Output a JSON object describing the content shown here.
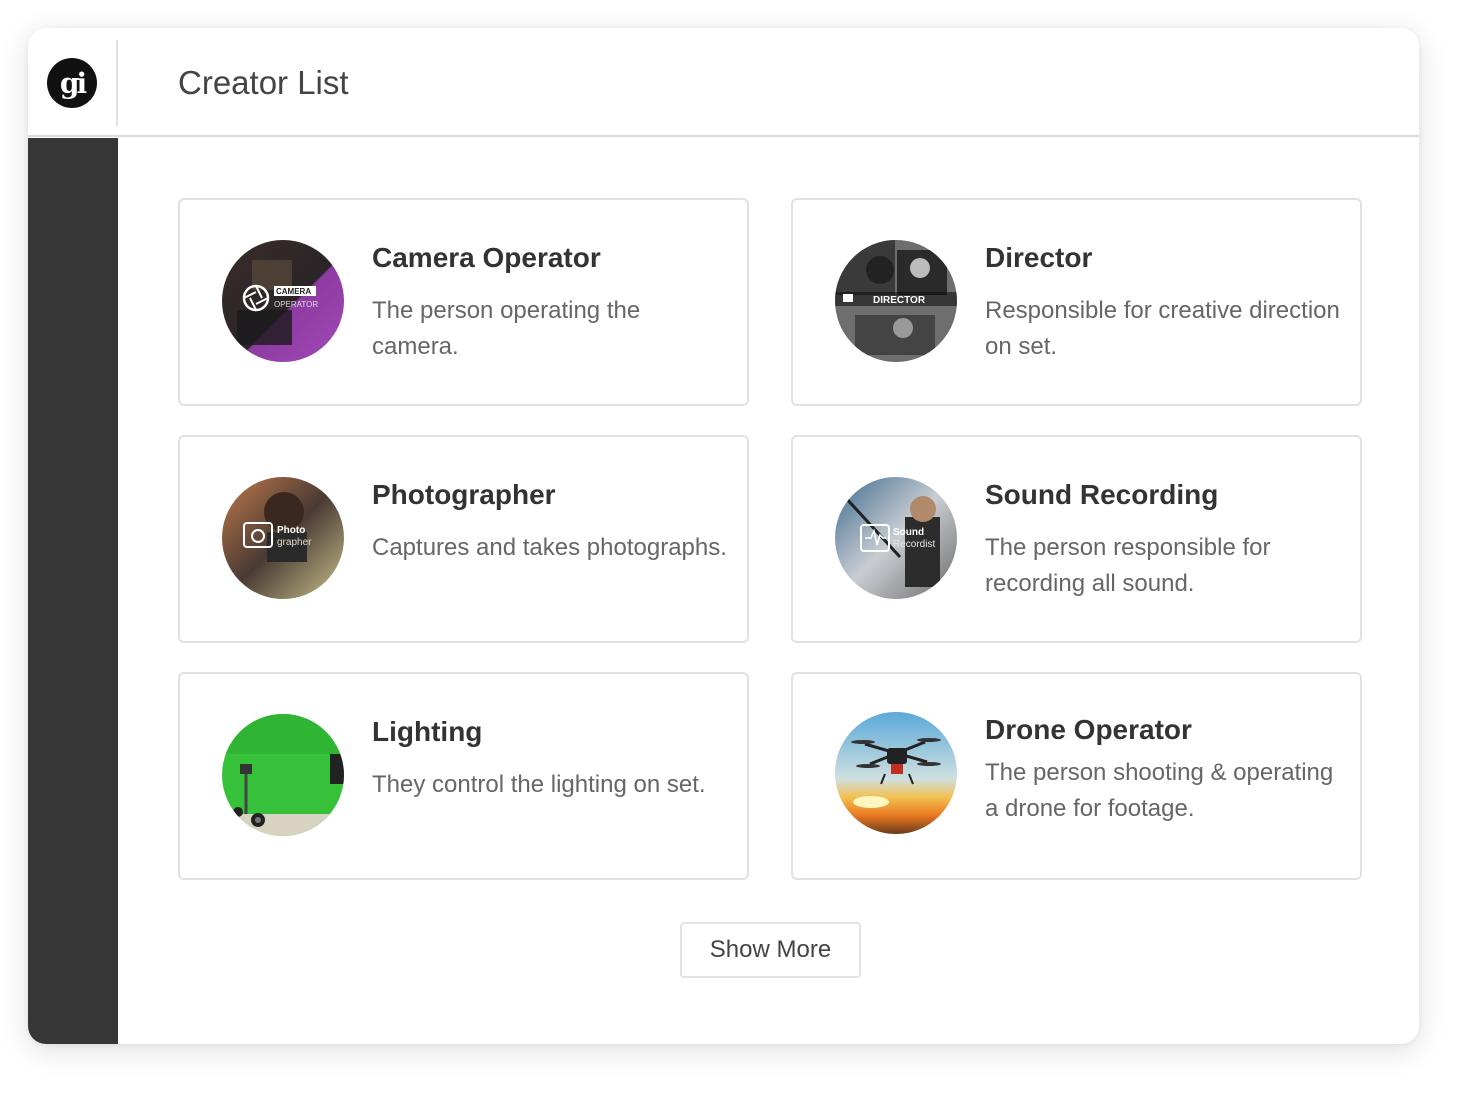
{
  "app": {
    "logo_text": "gi",
    "page_title": "Creator List"
  },
  "cards": [
    {
      "title": "Camera Operator",
      "desc": "The person operating the camera.",
      "badge": [
        "CAMERA",
        "OPERATOR"
      ],
      "icon": "camera-aperture-icon",
      "color": "#8e3aa3"
    },
    {
      "title": "Director",
      "desc": "Responsible for creative direction on set.",
      "badge": [
        "DIRECTOR",
        ""
      ],
      "icon": "clapperboard-icon",
      "color": "#555555"
    },
    {
      "title": "Photographer",
      "desc": "Captures and takes photographs.",
      "badge": [
        "Photo",
        "grapher"
      ],
      "icon": "camera-icon",
      "color": "#7a5a3a"
    },
    {
      "title": "Sound Recording",
      "desc": "The person responsible for recording all sound.",
      "badge": [
        "Sound",
        "Recordist"
      ],
      "icon": "sound-wave-icon",
      "color": "#3d6b8f"
    },
    {
      "title": "Lighting",
      "desc": "They control the lighting on set.",
      "badge": [
        "",
        ""
      ],
      "icon": "green-screen-icon",
      "color": "#35c23a"
    },
    {
      "title": "Drone Operator",
      "desc": "The person shooting & operating a drone for footage.",
      "badge": [
        "",
        ""
      ],
      "icon": "drone-icon",
      "color": "#f0a030"
    }
  ],
  "show_more_label": "Show More"
}
